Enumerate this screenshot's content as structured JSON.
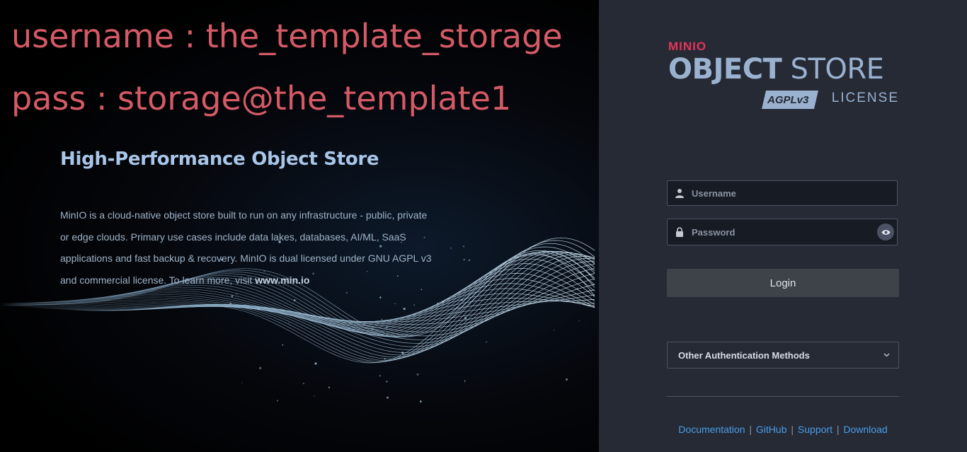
{
  "overlay": {
    "username_note": "username : the_template_storage",
    "password_note": "pass : storage@the_template1"
  },
  "hero": {
    "title": "High-Performance Object Store",
    "description": "MinIO is a cloud-native object store built to run on any infrastructure - public, private or edge clouds. Primary use cases include data lakes, databases, AI/ML, SaaS applications and fast backup & recovery. MinIO is dual licensed under GNU AGPL v3 and commercial license. To learn more, visit ",
    "link_text": "www.min.io"
  },
  "brand": {
    "minio": "MINIO",
    "object": "OBJECT",
    "store": " STORE",
    "agpl_badge": "AGPLv3",
    "license": "LICENSE"
  },
  "form": {
    "username_placeholder": "Username",
    "username_value": "",
    "password_placeholder": "Password",
    "password_value": "",
    "login_label": "Login",
    "other_auth_label": "Other Authentication Methods"
  },
  "footer": {
    "links": [
      "Documentation",
      "GitHub",
      "Support",
      "Download"
    ],
    "separator": "|"
  },
  "colors": {
    "overlay_text": "#d45a66",
    "panel_bg": "#252a35",
    "brand_red": "#e4345a",
    "brand_blue": "#9ab1cf",
    "link_blue": "#4b9ee8",
    "login_button": "#3d4348"
  },
  "icons": {
    "username": "user-icon",
    "password": "lock-icon",
    "reveal": "eye-icon",
    "dropdown": "chevron-down-icon"
  }
}
